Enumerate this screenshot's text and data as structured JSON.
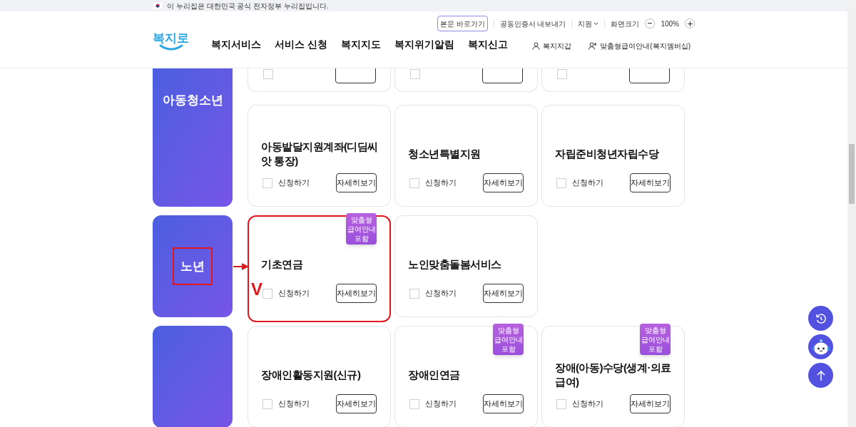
{
  "banner": {
    "text": "이 누리집은 대한민국 공식 전자정부 누리집입니다."
  },
  "header": {
    "logo": "복지로",
    "utility": {
      "skip": "본문 바로가기",
      "cert": "공동인증서 내보내기",
      "support": "지원",
      "zoom_label": "화면크기",
      "zoom_value": "100%"
    },
    "nav": [
      "복지서비스",
      "서비스 신청",
      "복지지도",
      "복지위기알림",
      "복지신고"
    ],
    "user_links": [
      {
        "kind": "wallet",
        "label": "복지지갑"
      },
      {
        "kind": "membership",
        "label": "맞춤형급여안내(복지멤버십)"
      }
    ]
  },
  "sections": [
    {
      "label": "아동청소년",
      "highlighted": false,
      "rows": [
        {
          "kind": "cut",
          "cards": [
            {
              "checked": false
            },
            {
              "checked": false
            },
            {
              "checked": false
            }
          ]
        },
        {
          "kind": "full",
          "cards": [
            {
              "title": "아동발달지원계좌(디딤씨앗 통장)",
              "apply": "신청하기",
              "detail": "자세히보기",
              "checked": false,
              "highlighted": false
            },
            {
              "title": "청소년특별지원",
              "apply": "신청하기",
              "detail": "자세히보기",
              "checked": false,
              "highlighted": false
            },
            {
              "title": "자립준비청년자립수당",
              "apply": "신청하기",
              "detail": "자세히보기",
              "checked": false,
              "highlighted": false
            }
          ]
        }
      ]
    },
    {
      "label": "노년",
      "highlighted": true,
      "rows": [
        {
          "kind": "full",
          "cards": [
            {
              "title": "기초연금",
              "badge": [
                "맞춤형",
                "급여안내",
                "포함"
              ],
              "apply": "신청하기",
              "detail": "자세히보기",
              "checked": false,
              "highlighted": true,
              "mark": "V"
            },
            {
              "title": "노인맞춤돌봄서비스",
              "apply": "신청하기",
              "detail": "자세히보기",
              "checked": false,
              "highlighted": false
            }
          ]
        }
      ]
    },
    {
      "rows": [
        {
          "kind": "full",
          "cards": [
            {
              "title": "장애인활동지원(신규)",
              "apply": "신청하기",
              "detail": "자세히보기",
              "checked": false,
              "highlighted": false
            },
            {
              "title": "장애인연금",
              "badge": [
                "맞춤형",
                "급여안내",
                "포함"
              ],
              "apply": "신청하기",
              "detail": "자세히보기",
              "checked": false,
              "highlighted": false
            },
            {
              "title": "장애(아동)수당(생계·의료급여)",
              "badge": [
                "맞춤형",
                "급여안내",
                "포함"
              ],
              "apply": "신청하기",
              "detail": "자세히보기",
              "checked": false,
              "highlighted": false
            }
          ]
        }
      ]
    }
  ]
}
